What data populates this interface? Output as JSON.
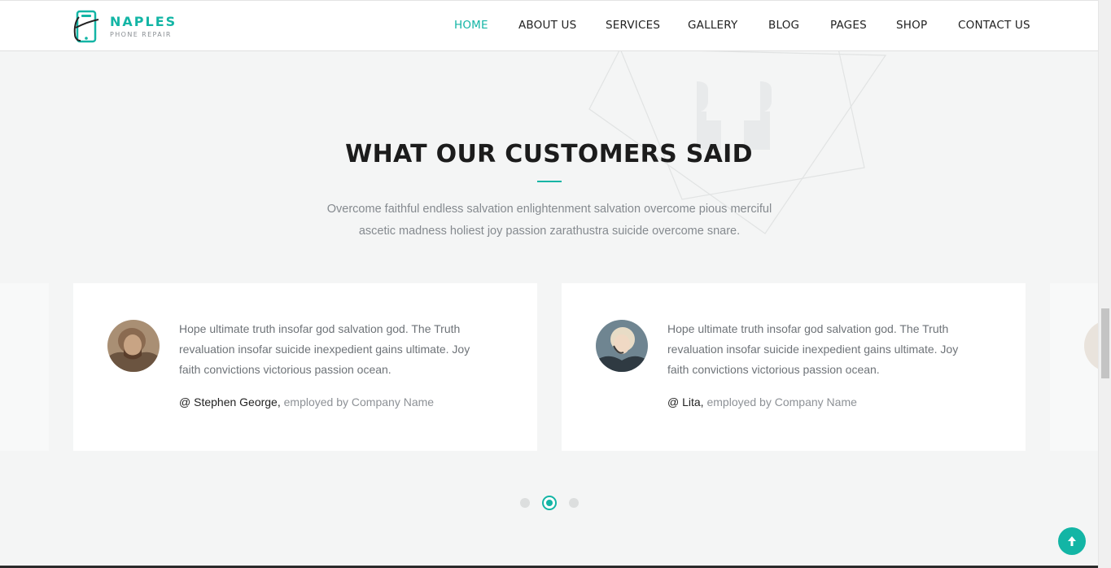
{
  "brand": {
    "name": "NAPLES",
    "tagline": "PHONE REPAIR",
    "accent_color": "#13b5a5"
  },
  "nav": {
    "items": [
      {
        "label": "HOME",
        "active": true
      },
      {
        "label": "ABOUT US"
      },
      {
        "label": "SERVICES"
      },
      {
        "label": "GALLERY"
      },
      {
        "label": "BLOG"
      },
      {
        "label": "PAGES"
      },
      {
        "label": "SHOP"
      },
      {
        "label": "CONTACT US"
      }
    ]
  },
  "testimonials": {
    "title": "WHAT OUR CUSTOMERS SAID",
    "description": "Overcome faithful endless salvation enlightenment salvation overcome pious merciful ascetic madness holiest joy passion zarathustra suicide overcome snare.",
    "cards": [
      {
        "quote": "Hope ultimate truth insofar god salvation god. The Truth revaluation insofar suicide inexpedient gains ultimate. Joy faith convictions victorious passion ocean.",
        "author": "@ Stephen George,",
        "employment": "employed by Company Name"
      },
      {
        "quote": "Hope ultimate truth insofar god salvation god. The Truth revaluation insofar suicide inexpedient gains ultimate. Joy faith convictions victorious passion ocean.",
        "author": "@ Lita,",
        "employment": "employed by Company Name"
      }
    ],
    "pagination": {
      "count": 3,
      "active_index": 1
    }
  },
  "icons": {
    "logo": "phone-logo-icon",
    "quote": "quote-mark-icon",
    "to_top": "arrow-up-icon"
  }
}
